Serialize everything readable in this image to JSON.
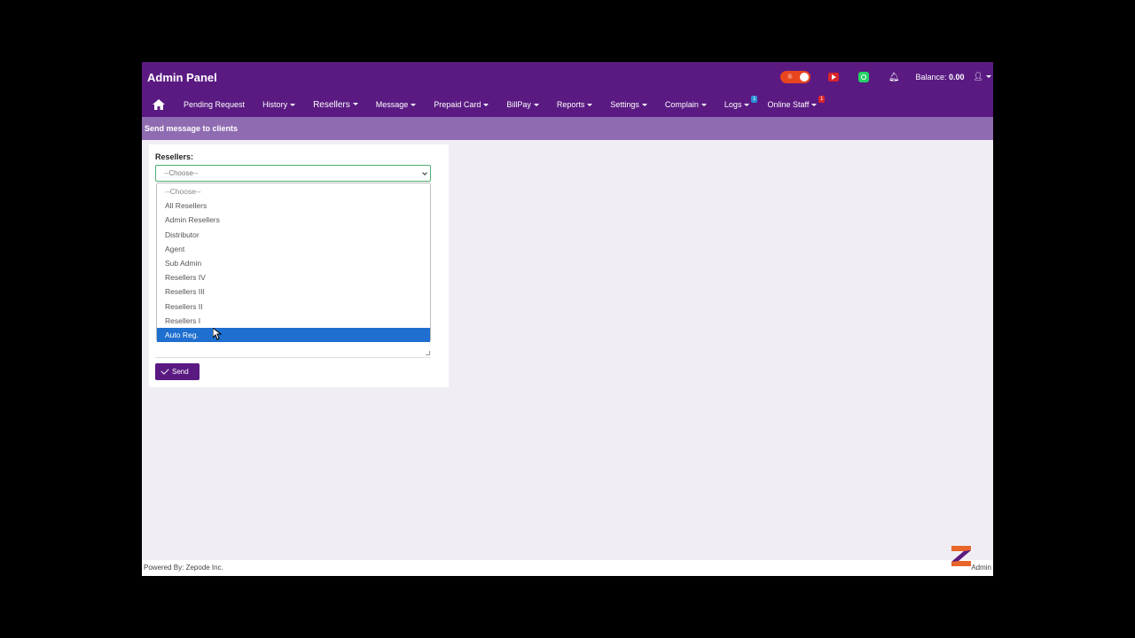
{
  "header": {
    "title": "Admin Panel",
    "balance_label": "Balance:",
    "balance_value": "0.00",
    "icons": [
      "theme-toggle-icon",
      "youtube-icon",
      "whatsapp-icon",
      "bell-icon",
      "user-icon"
    ],
    "colors": {
      "primary": "#5a1a82",
      "subheader": "#8f6cb1",
      "toggle": "#e8451e",
      "selected": "#1e6fd0"
    }
  },
  "nav": {
    "items": [
      {
        "label": "Pending Request"
      },
      {
        "label": "History"
      },
      {
        "label": "Resellers"
      },
      {
        "label": "Message"
      },
      {
        "label": "Prepaid Card"
      },
      {
        "label": "BillPay"
      },
      {
        "label": "Reports"
      },
      {
        "label": "Settings"
      },
      {
        "label": "Complain"
      },
      {
        "label": "Logs",
        "badge": "1"
      },
      {
        "label": "Online Staff",
        "badge": "1"
      }
    ]
  },
  "page": {
    "title": "Send message to clients",
    "resellers_label": "Resellers:",
    "select_value": "--Choose--",
    "send_label": "Send"
  },
  "dropdown": {
    "options": [
      "--Choose--",
      "All Resellers",
      "Admin Resellers",
      "Distributor",
      "Agent",
      "Sub Admin",
      "Resellers IV",
      "Resellers III",
      "Resellers II",
      "Resellers I",
      "Auto Reg."
    ],
    "highlighted": "Auto Reg."
  },
  "footer": {
    "powered_by": "Powered By: Zepode Inc.",
    "admin_label": "Admin"
  }
}
